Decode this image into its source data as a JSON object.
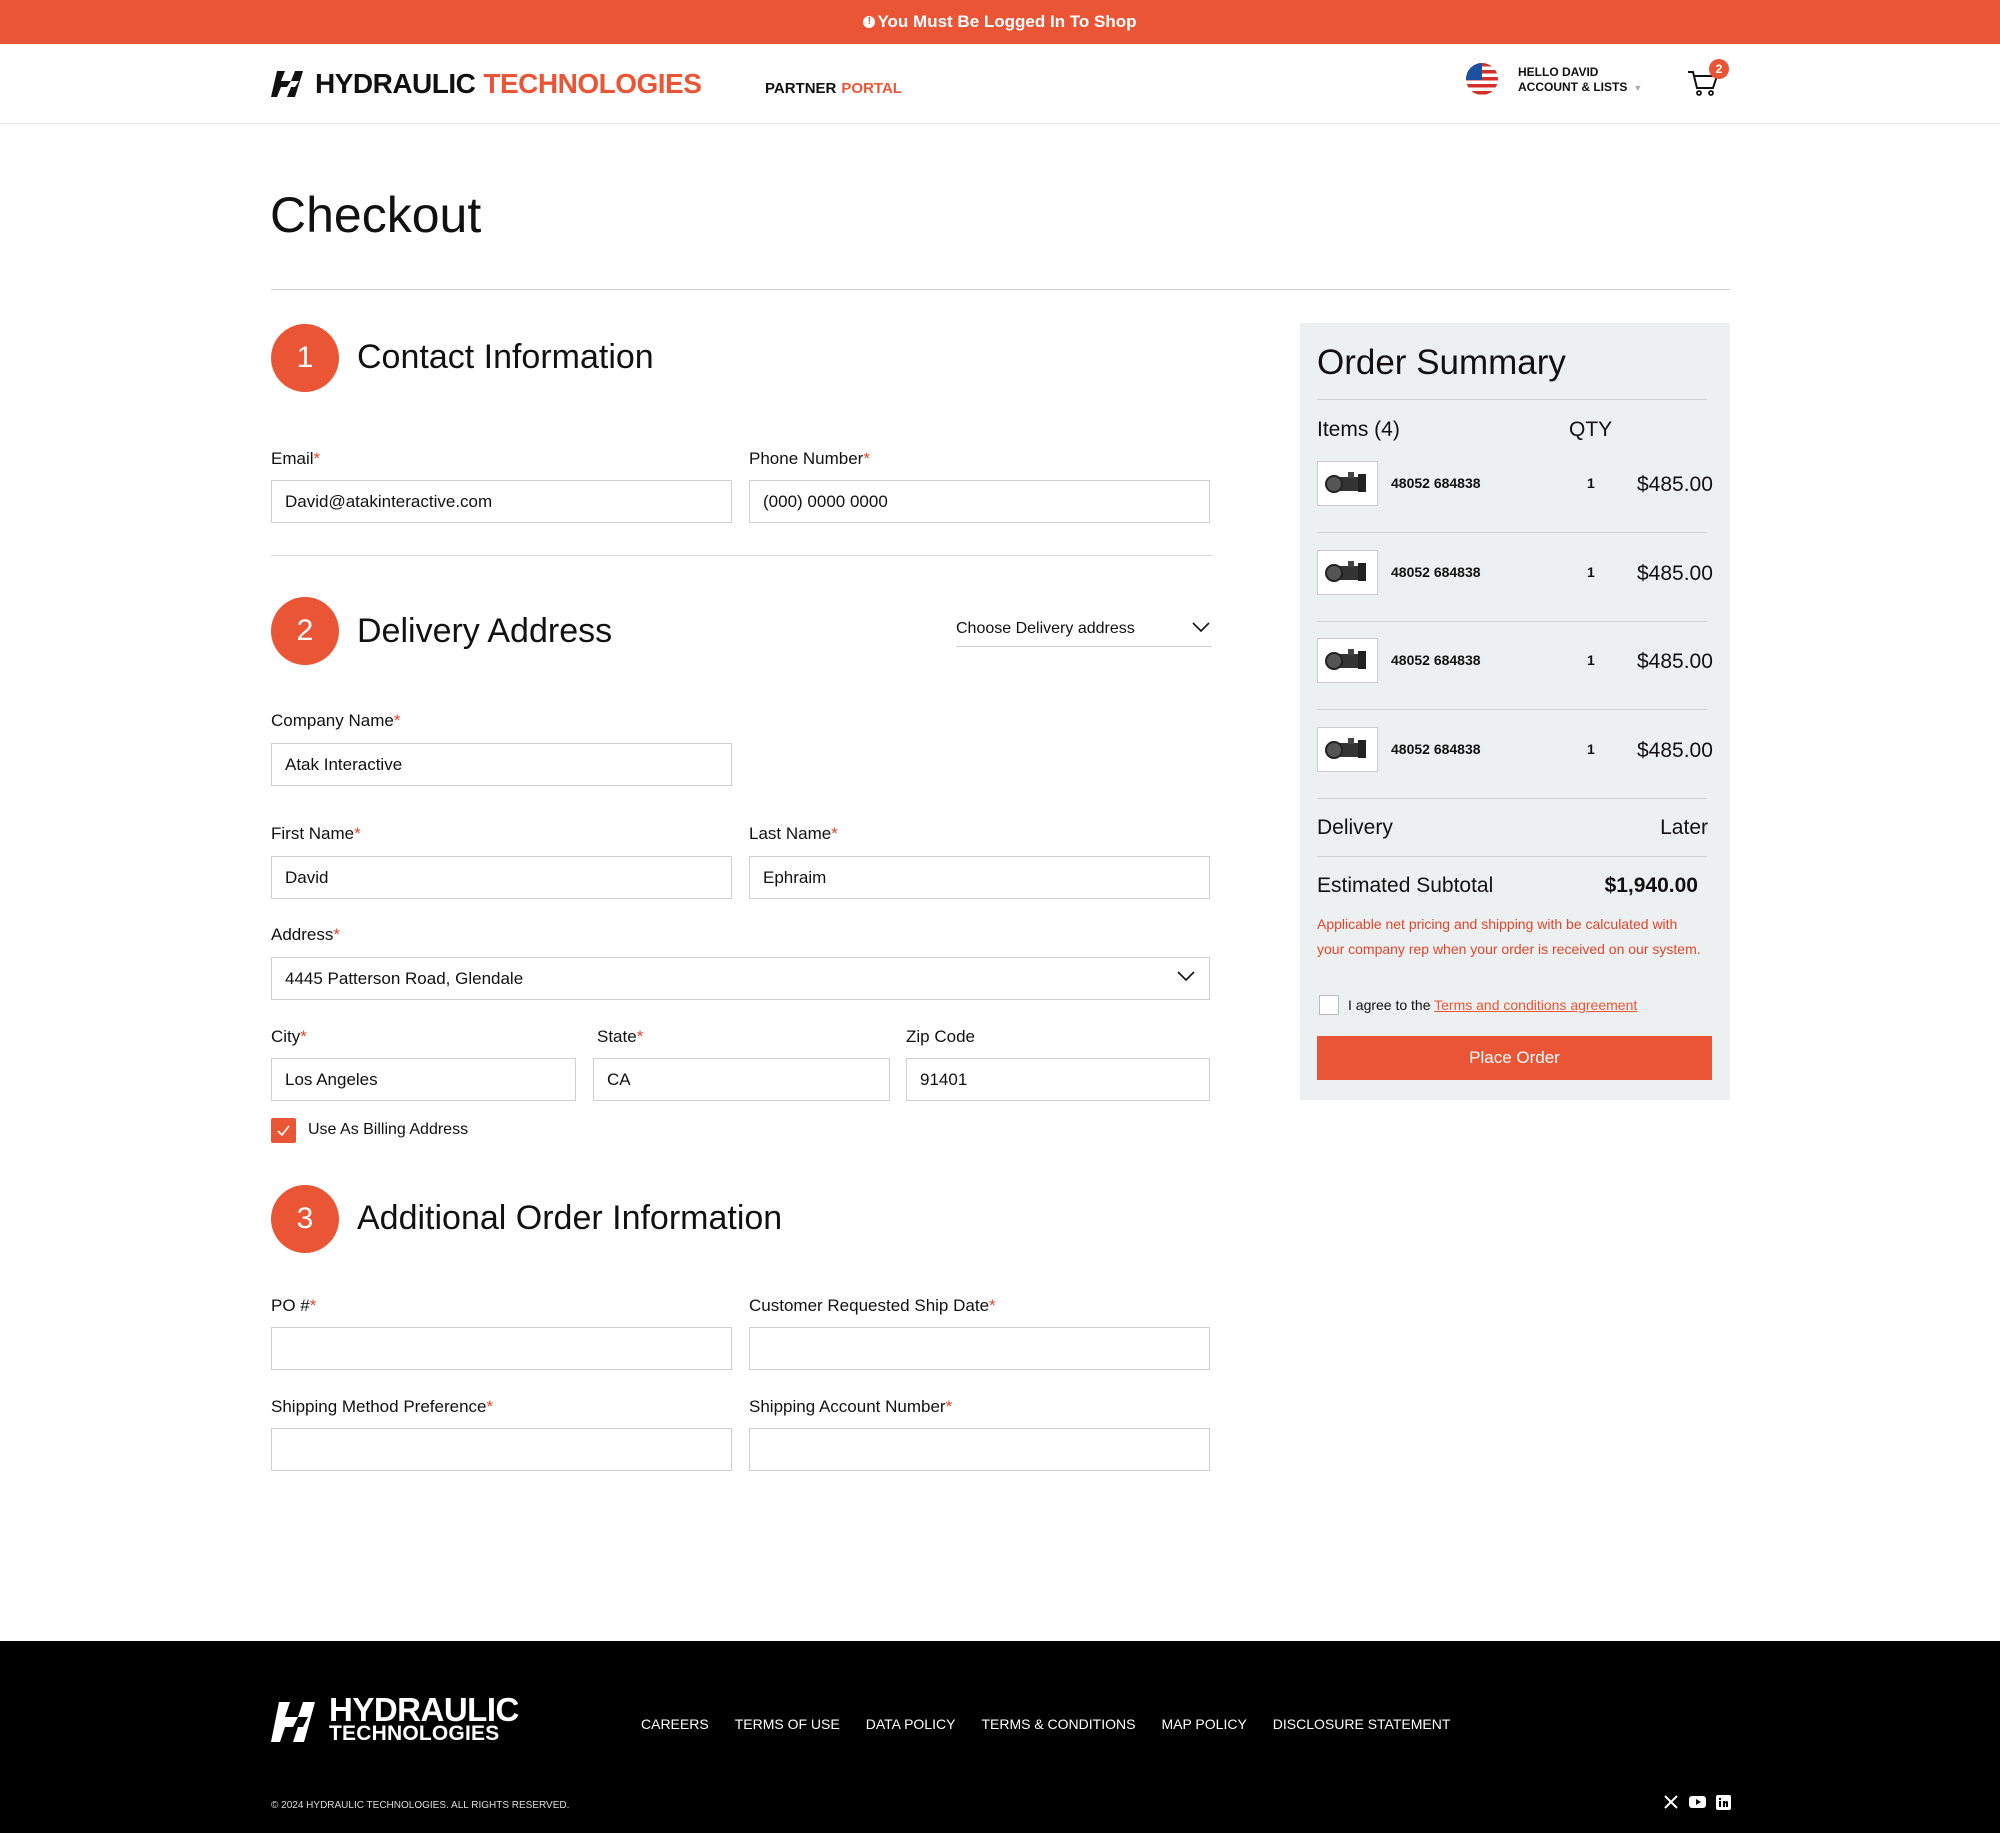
{
  "banner": {
    "info_icon": "info-icon",
    "text": "You Must Be Logged In To Shop"
  },
  "header": {
    "logo_word1": "HYDRAULIC",
    "logo_word2": "TECHNOLOGIES",
    "partner": "PARTNER",
    "portal": "PORTAL",
    "greeting": "HELLO DAVID",
    "account": "ACCOUNT & LISTS",
    "cart_count": "2"
  },
  "page_title": "Checkout",
  "contact": {
    "step": "1",
    "title": "Contact Information",
    "email_label": "Email",
    "email_value": "David@atakinteractive.com",
    "phone_label": "Phone Number",
    "phone_value": "(000) 0000 0000"
  },
  "delivery": {
    "step": "2",
    "title": "Delivery Address",
    "choose": "Choose Delivery address",
    "company_label": "Company Name",
    "company_value": "Atak Interactive",
    "first_label": "First Name",
    "first_value": "David",
    "last_label": "Last Name",
    "last_value": "Ephraim",
    "address_label": "Address",
    "address_value": "4445 Patterson Road, Glendale",
    "city_label": "City",
    "city_value": "Los Angeles",
    "state_label": "State",
    "state_value": "CA",
    "zip_label": "Zip Code",
    "zip_value": "91401",
    "billing_label": "Use As Billing Address"
  },
  "additional": {
    "step": "3",
    "title": "Additional Order Information",
    "po_label": "PO #",
    "ship_date_label": "Customer Requested Ship Date",
    "ship_method_label": "Shipping Method Preference",
    "ship_account_label": "Shipping Account Number"
  },
  "summary": {
    "title": "Order Summary",
    "items_head": "Items (4)",
    "qty_head": "QTY",
    "items": [
      {
        "sku": "48052 684838",
        "qty": "1",
        "price": "$485.00"
      },
      {
        "sku": "48052 684838",
        "qty": "1",
        "price": "$485.00"
      },
      {
        "sku": "48052 684838",
        "qty": "1",
        "price": "$485.00"
      },
      {
        "sku": "48052 684838",
        "qty": "1",
        "price": "$485.00"
      }
    ],
    "delivery_label": "Delivery",
    "delivery_value": "Later",
    "subtotal_label": "Estimated Subtotal",
    "subtotal_value": "$1,940.00",
    "note": "Applicable net pricing and shipping with be calculated with your company rep when your order is received on our system.",
    "agree_prefix": "I agree to the ",
    "agree_link": "Terms and conditions agreement",
    "place_order": "Place Order"
  },
  "footer": {
    "logo_word1": "HYDRAULIC",
    "logo_word2": "TECHNOLOGIES",
    "links": [
      "CAREERS",
      "TERMS OF USE",
      "DATA POLICY",
      "TERMS & CONDITIONS",
      "MAP POLICY",
      "DISCLOSURE STATEMENT"
    ],
    "copyright": "© 2024 HYDRAULIC TECHNOLOGIES. ALL RIGHTS RESERVED.",
    "social": [
      "x-icon",
      "youtube-icon",
      "linkedin-icon"
    ]
  },
  "colors": {
    "accent": "#ea5535",
    "panel": "#edf0f0",
    "footer": "#000000"
  }
}
